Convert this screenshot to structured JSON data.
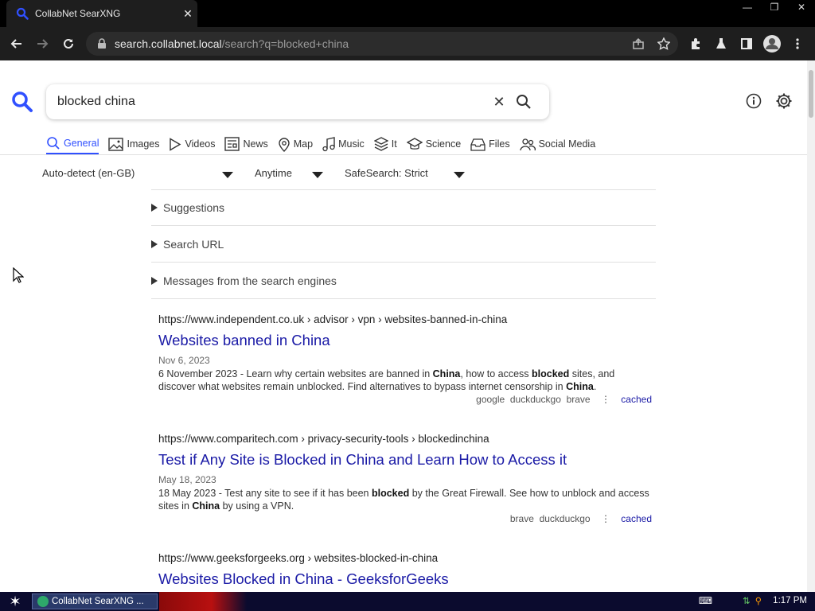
{
  "browser": {
    "tab_title": "CollabNet SearXNG",
    "url_host": "search.collabnet.local",
    "url_path": "/search?q=blocked+china"
  },
  "search": {
    "query": "blocked china"
  },
  "categories": [
    {
      "label": "General",
      "icon": "search-icon",
      "active": true
    },
    {
      "label": "Images",
      "icon": "image-icon"
    },
    {
      "label": "Videos",
      "icon": "play-icon"
    },
    {
      "label": "News",
      "icon": "newspaper-icon"
    },
    {
      "label": "Map",
      "icon": "map-pin-icon"
    },
    {
      "label": "Music",
      "icon": "music-icon"
    },
    {
      "label": "It",
      "icon": "layers-icon"
    },
    {
      "label": "Science",
      "icon": "graduation-cap-icon"
    },
    {
      "label": "Files",
      "icon": "inbox-icon"
    },
    {
      "label": "Social Media",
      "icon": "people-icon"
    }
  ],
  "filters": {
    "language": "Auto-detect (en-GB)",
    "time": "Anytime",
    "safesearch": "SafeSearch: Strict"
  },
  "panels": {
    "suggestions": "Suggestions",
    "search_url": "Search URL",
    "messages": "Messages from the search engines"
  },
  "results": [
    {
      "url_host": "https://www.independent.co.uk",
      "url_path": "› advisor › vpn › websites-banned-in-china",
      "title": "Websites banned in China",
      "date": "Nov 6, 2023",
      "snippet_parts": [
        "6 November 2023 - Learn why certain websites are banned in ",
        "China",
        ", how to access ",
        "blocked",
        " sites, and discover what websites remain unblocked. Find alternatives to bypass internet censorship in ",
        "China",
        "."
      ],
      "engines": [
        "google",
        "duckduckgo",
        "brave"
      ],
      "cached": "cached"
    },
    {
      "url_host": "https://www.comparitech.com",
      "url_path": "› privacy-security-tools › blockedinchina",
      "title": "Test if Any Site is Blocked in China and Learn How to Access it",
      "date": "May 18, 2023",
      "snippet_parts": [
        "18 May 2023 - Test any site to see if it has been ",
        "blocked",
        " by the Great Firewall. See how to unblock and access sites in ",
        "China",
        " by using a VPN."
      ],
      "engines": [
        "brave",
        "duckduckgo"
      ],
      "cached": "cached"
    },
    {
      "url_host": "https://www.geeksforgeeks.org",
      "url_path": "› websites-blocked-in-china",
      "title": "Websites Blocked in China - GeeksforGeeks"
    }
  ],
  "taskbar": {
    "item_label": "CollabNet SearXNG ...",
    "clock": "1:17 PM"
  },
  "colors": {
    "accent": "#3050ff",
    "link": "#1a1aa6"
  }
}
